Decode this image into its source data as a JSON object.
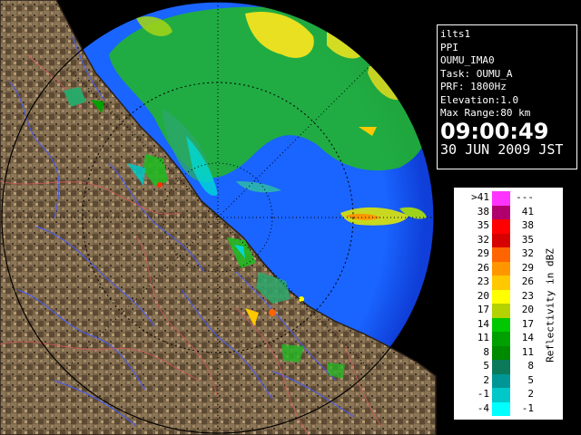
{
  "info_panel": {
    "product": "ilts1",
    "mode": "PPI",
    "site": "OUMU_IMA0",
    "task": "Task: OUMU_A",
    "prf": "PRF: 1800Hz",
    "elevation": "Elevation:1.0",
    "max_range": "Max Range:80 km",
    "time": "09:00:49",
    "date": "30 JUN 2009 JST"
  },
  "legend": {
    "unit": "Reflectivity in dBZ",
    "rows": [
      {
        "lo": ">41",
        "hi": "---",
        "color": "#ff33ff"
      },
      {
        "lo": "38",
        "hi": "41",
        "color": "#b0006e"
      },
      {
        "lo": "35",
        "hi": "38",
        "color": "#ff0000"
      },
      {
        "lo": "32",
        "hi": "35",
        "color": "#d70000"
      },
      {
        "lo": "29",
        "hi": "32",
        "color": "#ff6400"
      },
      {
        "lo": "26",
        "hi": "29",
        "color": "#ff9600"
      },
      {
        "lo": "23",
        "hi": "26",
        "color": "#ffc800"
      },
      {
        "lo": "20",
        "hi": "23",
        "color": "#ffff00"
      },
      {
        "lo": "17",
        "hi": "20",
        "color": "#b4d200"
      },
      {
        "lo": "14",
        "hi": "17",
        "color": "#00c800"
      },
      {
        "lo": "11",
        "hi": "14",
        "color": "#00a000"
      },
      {
        "lo": "8",
        "hi": "11",
        "color": "#008a00"
      },
      {
        "lo": "5",
        "hi": "8",
        "color": "#0a7a5a"
      },
      {
        "lo": "2",
        "hi": "5",
        "color": "#009696"
      },
      {
        "lo": "-1",
        "hi": "2",
        "color": "#00c8c8"
      },
      {
        "lo": "-4",
        "hi": "-1",
        "color": "#00ffff"
      }
    ]
  },
  "colors": {
    "sea": "#1a64ff",
    "sea_edge": "#0f3fd8",
    "land": "#7a6448",
    "range_rings": "#000000",
    "rivers": "#4a5cf0",
    "boundaries": "#d05a5a"
  }
}
